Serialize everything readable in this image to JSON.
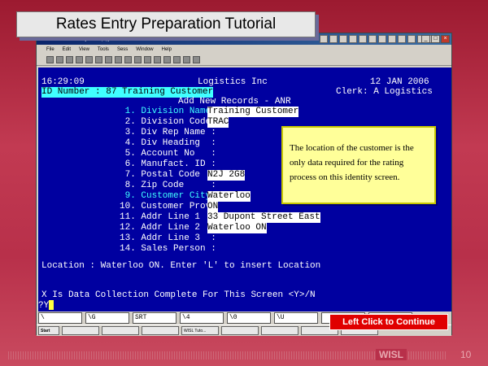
{
  "slide": {
    "title": "Rates Entry Preparation Tutorial",
    "continue_label": "Left Click to Continue",
    "footer_logo": "WISL",
    "page_number": "10"
  },
  "window": {
    "title": "AccuTerm 97 - [Rstl1 (1)]",
    "menu": [
      "File",
      "Edit",
      "View",
      "Tools",
      "Sess",
      "Window",
      "Help"
    ]
  },
  "terminal": {
    "time": "16:29:09",
    "company": "Logistics Inc",
    "date": "12 JAN 2006",
    "id_line": "ID Number : 87 Training Customer",
    "clerk": "Clerk: A Logistics",
    "screen_title": "Add New Records - ANR",
    "fields": [
      {
        "label": " 1. Division Name:",
        "value": "Training Customer"
      },
      {
        "label": " 2. Division Code:",
        "value": "TRAC"
      },
      {
        "label": " 3. Div Rep Name :",
        "value": ""
      },
      {
        "label": " 4. Div Heading  :",
        "value": ""
      },
      {
        "label": " 5. Account No   :",
        "value": ""
      },
      {
        "label": " 6. Manufact. ID :",
        "value": ""
      },
      {
        "label": " 7. Postal Code  :",
        "value": "N2J 2G8"
      },
      {
        "label": " 8. Zip Code     :",
        "value": ""
      },
      {
        "label": " 9. Customer City:",
        "value": "Waterloo"
      },
      {
        "label": "10. Customer Prov:",
        "value": "ON"
      },
      {
        "label": "11. Addr Line 1  :",
        "value": "33 Dupont Street East"
      },
      {
        "label": "12. Addr Line 2  :",
        "value": "Waterloo ON"
      },
      {
        "label": "13. Addr Line 3  :",
        "value": ""
      },
      {
        "label": "14. Sales Person :",
        "value": ""
      }
    ],
    "location_line": "Location : Waterloo ON. Enter 'L' to insert Location",
    "prompt_line": "X Is Data Collection Complete For This Screen <Y>/N",
    "input_prompt": "?Y",
    "fkeys": [
      "\\",
      "\\G",
      "SRT",
      "\\4",
      "\\0",
      "\\U",
      "",
      ""
    ]
  },
  "callout": {
    "text": "The location of the customer is the only data required for the rating process on this identity screen."
  },
  "taskbar": {
    "start": "Start",
    "items": [
      "",
      "",
      "",
      "WISL Tuto...",
      "",
      "",
      "",
      ""
    ]
  }
}
